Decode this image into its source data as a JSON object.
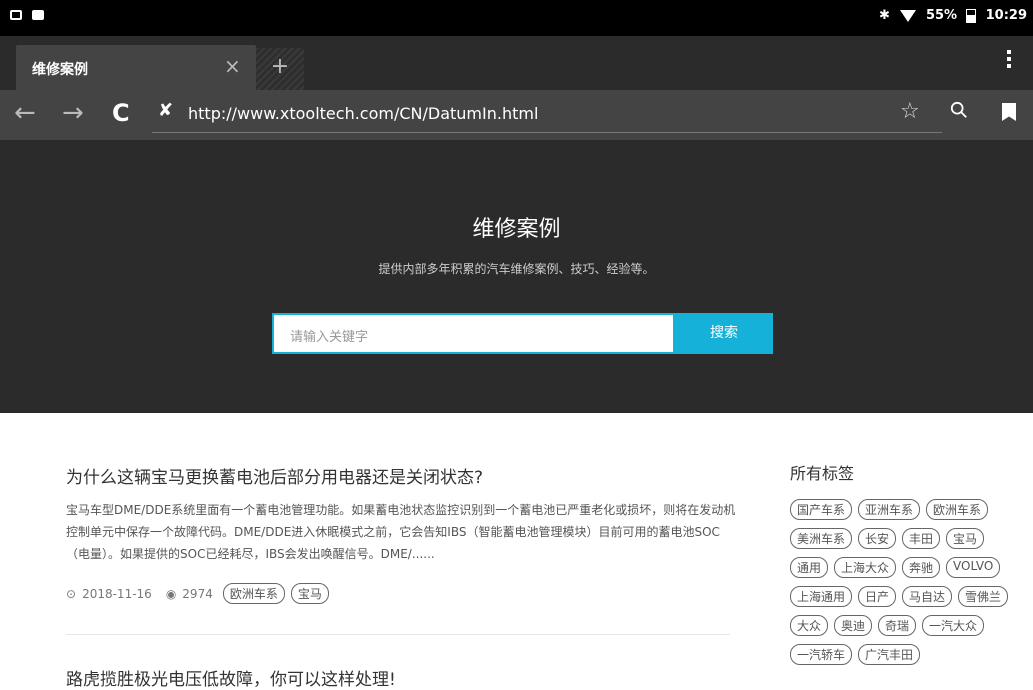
{
  "status_bar": {
    "battery": "55%",
    "time": "10:29",
    "icons": [
      "image-icon",
      "notification-icon",
      "bluetooth-icon",
      "wifi-icon",
      "battery-icon"
    ]
  },
  "browser": {
    "tab_title": "维修案例",
    "close_symbol": "×",
    "newtab_symbol": "+",
    "url": "http://www.xtooltech.com/CN/DatumIn.html",
    "nav": {
      "back": "←",
      "forward": "→",
      "reload": "C"
    }
  },
  "hero": {
    "title": "维修案例",
    "subtitle": "提供内部多年积累的汽车维修案例、技巧、经验等。",
    "search_placeholder": "请输入关键字",
    "search_button": "搜索",
    "accent_color": "#16b1d8"
  },
  "articles": [
    {
      "title": "为什么这辆宝马更换蓄电池后部分用电器还是关闭状态?",
      "summary": "宝马车型DME/DDE系统里面有一个蓄电池管理功能。如果蓄电池状态监控识别到一个蓄电池已严重老化或损坏，则将在发动机控制单元中保存一个故障代码。DME/DDE进入休眠模式之前，它会告知IBS（智能蓄电池管理模块）目前可用的蓄电池SOC（电量）。如果提供的SOC已经耗尽，IBS会发出唤醒信号。DME/......",
      "date": "2018-11-16",
      "views": "2974",
      "tags": [
        "欧洲车系",
        "宝马"
      ]
    },
    {
      "title": "路虎揽胜极光电压低故障，你可以这样处理!"
    }
  ],
  "sidebar": {
    "title": "所有标签",
    "tags": [
      "国产车系",
      "亚洲车系",
      "欧洲车系",
      "美洲车系",
      "长安",
      "丰田",
      "宝马",
      "通用",
      "上海大众",
      "奔驰",
      "VOLVO",
      "上海通用",
      "日产",
      "马自达",
      "雪佛兰",
      "大众",
      "奥迪",
      "奇瑞",
      "一汽大众",
      "一汽轿车",
      "广汽丰田"
    ]
  }
}
